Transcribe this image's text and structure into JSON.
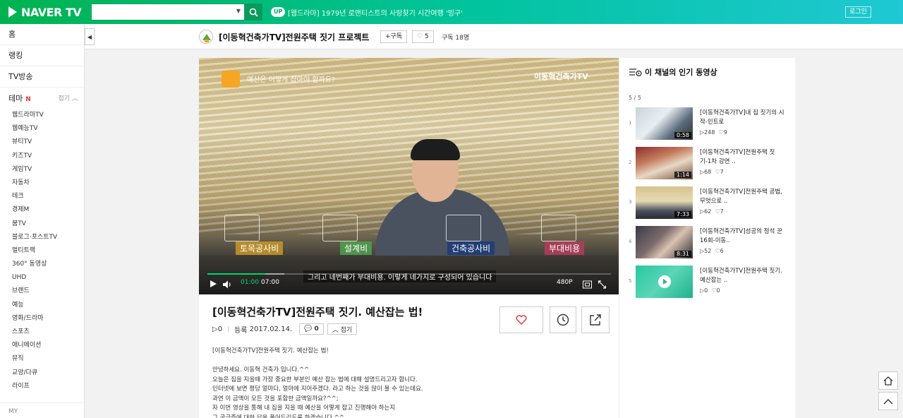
{
  "brand": {
    "logo_text": "NAVER TV"
  },
  "search": {
    "placeholder": ""
  },
  "ticker": {
    "badge": "UP",
    "text": "[웹드라마] 1979년 로맨티스트의 사랑찾기 시간여행 '빙구'"
  },
  "login_label": "로그인",
  "sidebar": {
    "main": [
      {
        "label": "홈"
      },
      {
        "label": "랭킹"
      },
      {
        "label": "TV방송"
      }
    ],
    "theme_label": "테마",
    "theme_new": "N",
    "fold_label": "접기",
    "sub": [
      {
        "label": "웹드라마TV"
      },
      {
        "label": "웹예능TV"
      },
      {
        "label": "뷰티TV"
      },
      {
        "label": "키즈TV"
      },
      {
        "label": "게임TV"
      },
      {
        "label": "자동차"
      },
      {
        "label": "테크"
      },
      {
        "label": "경제M"
      },
      {
        "label": "붐TV"
      },
      {
        "label": "블로그·포스트TV"
      },
      {
        "label": "멀티트랙"
      },
      {
        "label": "360° 동영상"
      },
      {
        "label": "UHD"
      },
      {
        "label": "브랜드"
      },
      {
        "label": "예능"
      },
      {
        "label": "영화/드라마"
      },
      {
        "label": "스포츠"
      },
      {
        "label": "애니메이션"
      },
      {
        "label": "뮤직"
      },
      {
        "label": "교양/다큐"
      },
      {
        "label": "라이프"
      }
    ],
    "my_label": "MY"
  },
  "channel": {
    "title": "[이동혁건축가TV]전원주택 짓기 프로젝트",
    "subscribe_label": "+구독",
    "like_count": "5",
    "subscribers": "구독 18명"
  },
  "player": {
    "question_text": "예산은 어떻게 잡아야 할까요?",
    "brand_mark": "이동혁건축가TV",
    "categories": [
      {
        "label": "토목공사비"
      },
      {
        "label": "설계비"
      },
      {
        "label": "건축공사비"
      },
      {
        "label": "부대비용"
      }
    ],
    "caption": "그리고 네번째가 부대비용. 이렇게 네가지로 구성되어 있습니다",
    "current_time": "01:00",
    "total_time": "07:00",
    "progress": 0.143,
    "buffered": 0.19,
    "quality": "480P"
  },
  "video": {
    "title": "[이동혁건축가TV]전원주택 짓기. 예산잡는 법!",
    "plays": "0",
    "date_label": "등록",
    "date": "2017.02.14.",
    "comment_count": "0",
    "fold_label": "접기",
    "description": "[이동혁건축가TV]전원주택 짓기. 예산잡는 법!\n\n안녕하세요. 이동혁 건축가 입니다.^^\n오늘은 집을 지을때 가장 중요한 부분인 예산 잡는 법에 대해 설명드리고자 합니다.\n인터넷에 보면 평당 얼마다, 얼마에 지어주겠다. 라고 하는 것을 많이 볼 수 있는데요.\n과연 이 금액이 모든 것을 포함한 금액일까요?^^;\n자 이번 영상을 통해 내 집을 지을 때 예산을 어떻게 잡고 진행해야 하는지\n그 궁금증에 대한 답을 풀어드리도록 하겠습니다.^^"
  },
  "panel": {
    "title": "이 채널의 인기 동영상",
    "count": "5 / 5",
    "items": [
      {
        "num": "1",
        "title": "[이동혁건축가TV]내 집 짓기의 시작-인트로",
        "duration": "0:58",
        "plays": "248",
        "likes": "9"
      },
      {
        "num": "2",
        "title": "[이동혁건축가TV]전원주택 짓기-1차 강연 ..",
        "duration": "1:14",
        "plays": "68",
        "likes": "7"
      },
      {
        "num": "3",
        "title": "[이동혁건축가TV]전원주택 공법, 무엇으로 ..",
        "duration": "7:33",
        "plays": "62",
        "likes": "7"
      },
      {
        "num": "4",
        "title": "[이동혁건축가TV]성공의 정석 꾼 16회-이동..",
        "duration": "8:31",
        "plays": "52",
        "likes": "6"
      },
      {
        "num": "5",
        "title": "[이동혁건축가TV]전원주택 짓기. 예산잡는 ..",
        "duration": "",
        "plays": "0",
        "likes": "0"
      }
    ]
  },
  "colors": {
    "accent": "#00c73c",
    "progress": "#00d36b",
    "like": "#e43d47"
  }
}
